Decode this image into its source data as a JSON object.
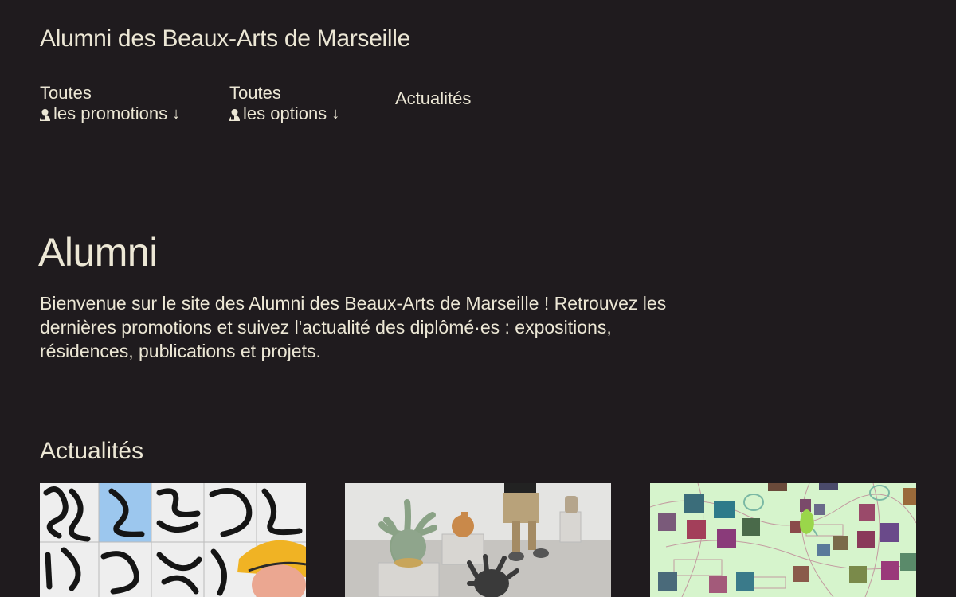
{
  "header": {
    "site_title": "Alumni des Beaux-Arts de Marseille"
  },
  "nav": {
    "promotions": {
      "line1": "Toutes",
      "line2": "les promotions",
      "arrow": "↓",
      "icon": "person-icon"
    },
    "options": {
      "line1": "Toutes",
      "line2": "les options",
      "arrow": "↓",
      "icon": "person-icon"
    },
    "actualites": "Actualités"
  },
  "hero": {
    "title": "Alumni",
    "intro": "Bienvenue sur le site des Alumni des Beaux-Arts de Marseille ! Retrouvez les dernières promotions et suivez l'actualité des diplômé·es : expositions, résidences, publications et projets."
  },
  "news": {
    "title": "Actualités"
  },
  "colors": {
    "background": "#1f1b1e",
    "text": "#ece7d5"
  }
}
